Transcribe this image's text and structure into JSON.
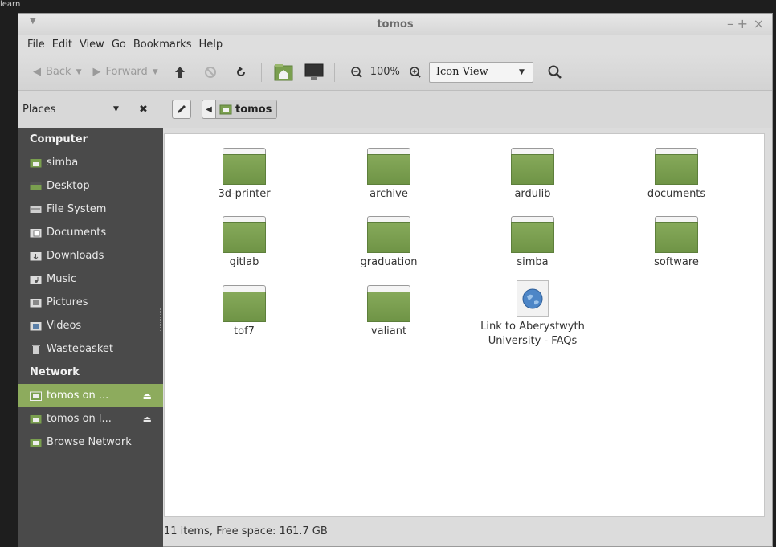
{
  "desktop": {
    "fragment": "learn"
  },
  "window": {
    "title": "tomos"
  },
  "menubar": [
    "File",
    "Edit",
    "View",
    "Go",
    "Bookmarks",
    "Help"
  ],
  "toolbar": {
    "back": "Back",
    "forward": "Forward",
    "zoom": "100%",
    "view_mode": "Icon View"
  },
  "sidebar_header": {
    "label": "Places"
  },
  "breadcrumb": {
    "current": "tomos"
  },
  "sidebar": {
    "computer": {
      "heading": "Computer",
      "items": [
        "simba",
        "Desktop",
        "File System",
        "Documents",
        "Downloads",
        "Music",
        "Pictures",
        "Videos",
        "Wastebasket"
      ]
    },
    "network": {
      "heading": "Network",
      "items": [
        "tomos on ...",
        "tomos on l...",
        "Browse Network"
      ]
    }
  },
  "files": [
    {
      "name": "3d-printer",
      "kind": "folder"
    },
    {
      "name": "archive",
      "kind": "folder"
    },
    {
      "name": "ardulib",
      "kind": "folder"
    },
    {
      "name": "documents",
      "kind": "folder"
    },
    {
      "name": "gitlab",
      "kind": "folder"
    },
    {
      "name": "graduation",
      "kind": "folder"
    },
    {
      "name": "simba",
      "kind": "folder"
    },
    {
      "name": "software",
      "kind": "folder"
    },
    {
      "name": "tof7",
      "kind": "folder"
    },
    {
      "name": "valiant",
      "kind": "folder"
    },
    {
      "name": "Link to Aberystwyth University - FAQs",
      "kind": "link",
      "line1": "Link to Aberystwyth",
      "line2": "University - FAQs"
    }
  ],
  "status": "11 items, Free space: 161.7 GB",
  "colors": {
    "sidebar_bg": "#4a4a4a",
    "selection": "#8dab5d",
    "folder": "#7a9f4f"
  }
}
